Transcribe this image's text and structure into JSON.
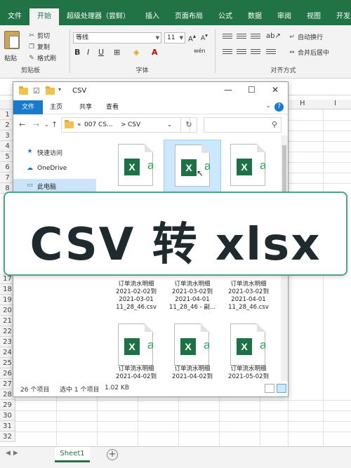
{
  "excel": {
    "tabs": [
      "文件",
      "开始",
      "超级处理器（尝鲜）",
      "插入",
      "页面布局",
      "公式",
      "数据",
      "审阅",
      "视图",
      "开发工具"
    ],
    "active_tab": "开始",
    "clipboard": {
      "paste_label": "粘贴",
      "cut_label": "剪切",
      "copy_label": "复制",
      "format_painter_label": "格式刷",
      "group_label": "剪贴板"
    },
    "font": {
      "font_name": "等线",
      "font_size": "11",
      "group_label": "字体"
    },
    "alignment": {
      "wrap_label": "自动换行",
      "merge_label": "合并后居中",
      "group_label": "对齐方式"
    },
    "columns": [
      "H",
      "I"
    ],
    "rows_top": [
      "1",
      "2",
      "3",
      "4",
      "5",
      "6",
      "7",
      "8"
    ],
    "rows_bottom": [
      "17",
      "18",
      "19",
      "20",
      "21",
      "22",
      "23",
      "24",
      "25",
      "26",
      "27",
      "28",
      "29",
      "30",
      "31",
      "32",
      "33"
    ],
    "sheet_tab": "Sheet1"
  },
  "explorer": {
    "title": "CSV",
    "ribbon_tabs": [
      "文件",
      "主页",
      "共享",
      "查看"
    ],
    "address_crumbs": [
      "«",
      "007 CS...",
      ">",
      "CSV"
    ],
    "nav_items": [
      {
        "label": "快速访问",
        "icon": "star-icon"
      },
      {
        "label": "OneDrive",
        "icon": "cloud-icon"
      },
      {
        "label": "此电脑",
        "icon": "computer-icon"
      }
    ],
    "files_row2": [
      {
        "lines": [
          "订单流水明细",
          "2021-02-02到",
          "2021-03-01",
          "11_28_46.csv"
        ]
      },
      {
        "lines": [
          "订单流水明细",
          "2021-03-02到",
          "2021-04-01",
          "11_28_46 - 副..."
        ]
      },
      {
        "lines": [
          "订单流水明细",
          "2021-03-02到",
          "2021-04-01",
          "11_28_46.csv"
        ]
      }
    ],
    "files_row3": [
      {
        "lines": [
          "订单流水明细",
          "2021-04-02到"
        ]
      },
      {
        "lines": [
          "订单流水明细",
          "2021-04-02到"
        ]
      },
      {
        "lines": [
          "订单流水明细",
          "2021-05-02到"
        ]
      }
    ],
    "status": {
      "count": "26 个项目",
      "selection": "选中 1 个项目",
      "size": "1.02 KB"
    }
  },
  "banner": {
    "part1": "CSV 转 xl",
    "part2": "sx"
  },
  "colors": {
    "excel_green": "#217346",
    "banner_border": "#4ba68a",
    "explorer_blue": "#1979ca"
  }
}
